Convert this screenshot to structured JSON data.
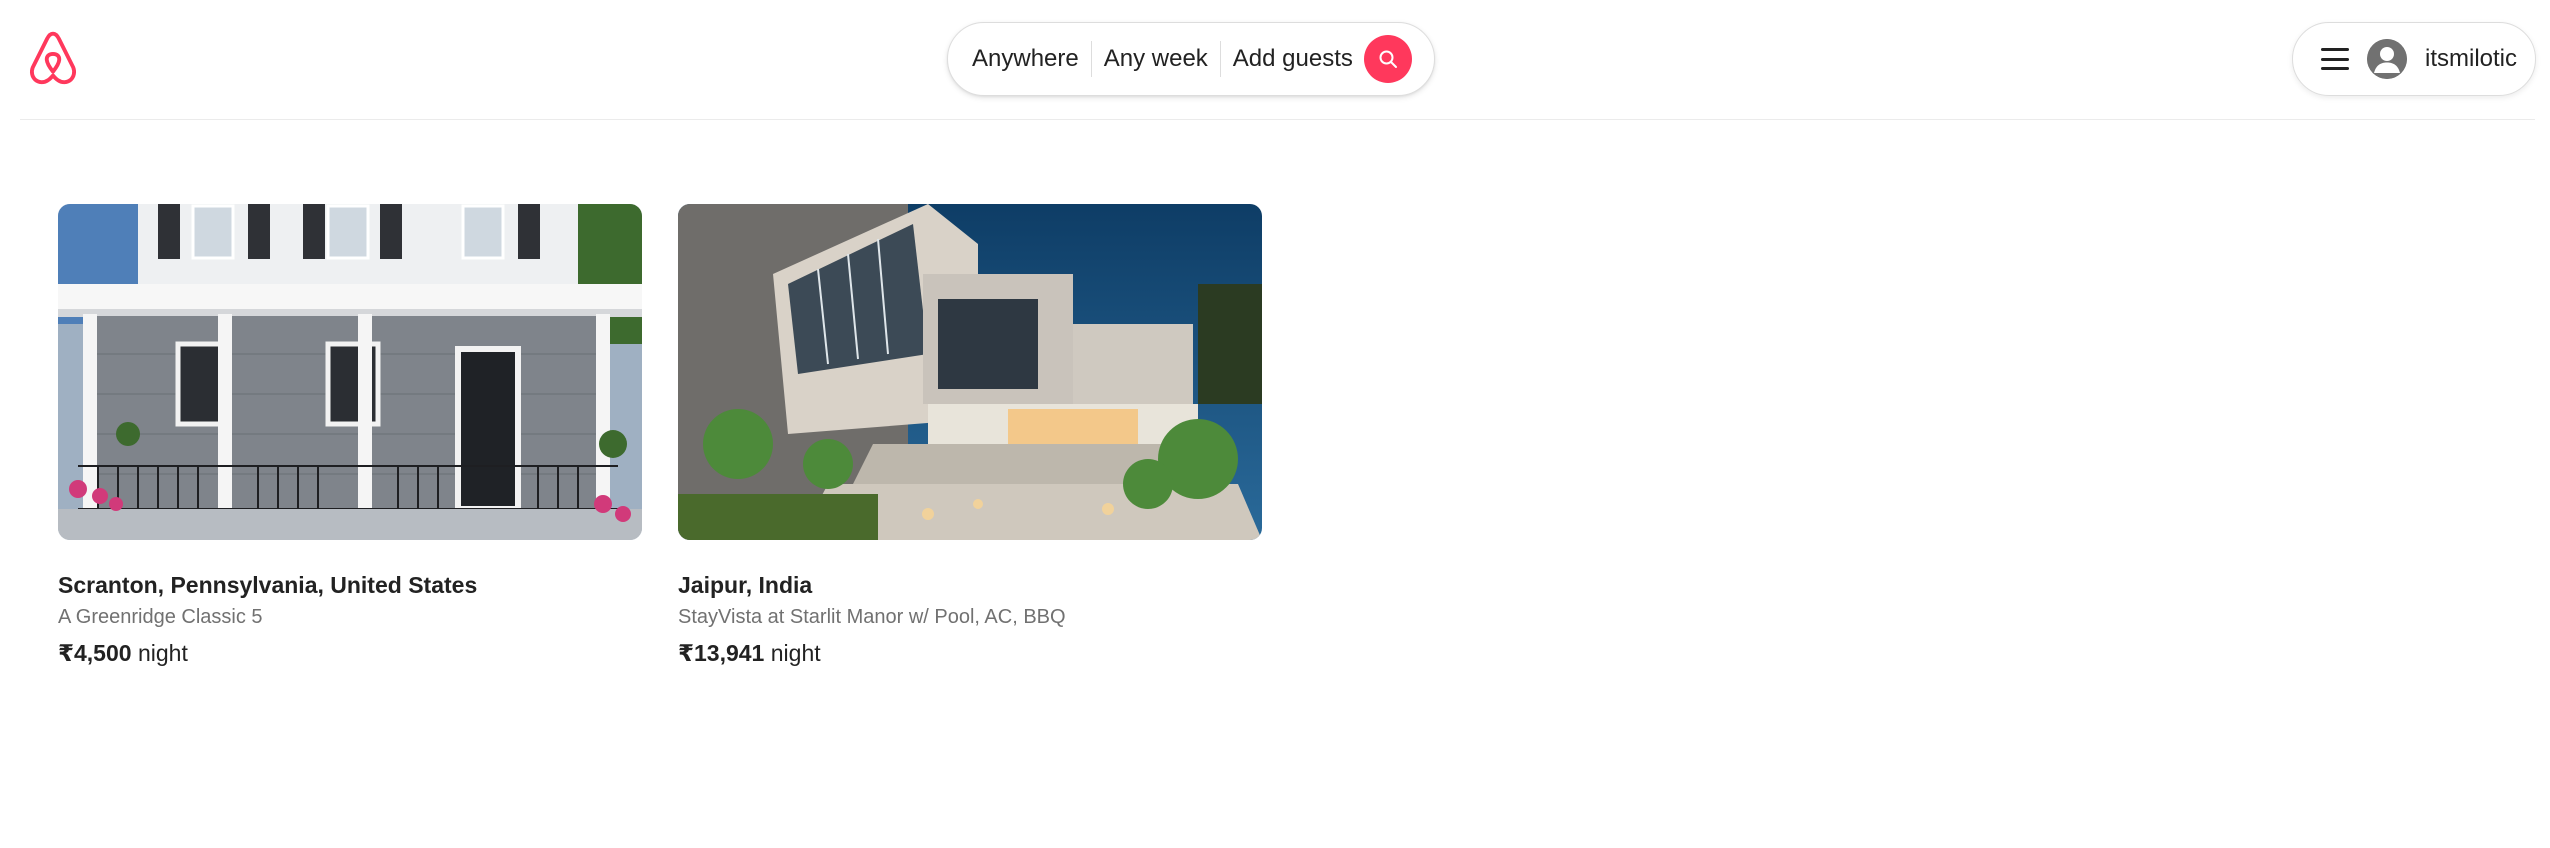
{
  "header": {
    "logo_icon": "airbnb-logo-icon",
    "brand_color": "#ff385c",
    "search": {
      "anywhere": "Anywhere",
      "any_week": "Any week",
      "add_guests": "Add guests",
      "search_icon": "search-icon"
    },
    "user_menu": {
      "menu_icon": "hamburger-menu-icon",
      "avatar_icon": "user-avatar-icon",
      "username": "itsmilotic"
    }
  },
  "listings": [
    {
      "location": "Scranton, Pennsylvania, United States",
      "name": "A Greenridge Classic 5",
      "price": "₹4,500",
      "price_unit": "night",
      "image": "house-photo-icon"
    },
    {
      "location": "Jaipur, India",
      "name": "StayVista at Starlit Manor w/ Pool, AC, BBQ",
      "price": "₹13,941",
      "price_unit": "night",
      "image": "villa-photo-icon"
    }
  ]
}
